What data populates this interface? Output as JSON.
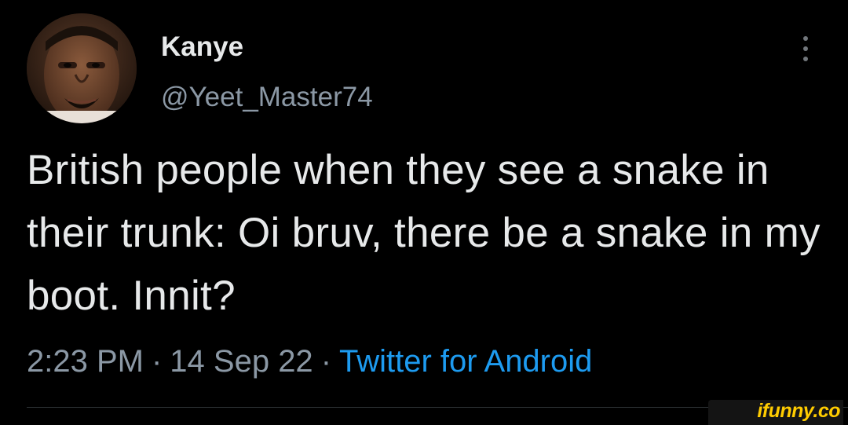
{
  "tweet": {
    "author": {
      "display_name": "Kanye",
      "handle": "@Yeet_Master74",
      "avatar_icon": "profile-photo"
    },
    "more_icon": "more-vertical-icon",
    "text": "British people when they see a snake in their trunk: Oi bruv, there be a snake in my boot. Innit?",
    "meta": {
      "time": "2:23 PM",
      "separator": "·",
      "date": "14 Sep 22",
      "source": "Twitter for Android"
    }
  },
  "watermark": {
    "text": "ifunny.co"
  },
  "colors": {
    "background": "#000000",
    "primary_text": "#e7e9ea",
    "secondary_text": "#8b98a5",
    "link": "#1d9bf0",
    "watermark": "#ffcc00"
  }
}
